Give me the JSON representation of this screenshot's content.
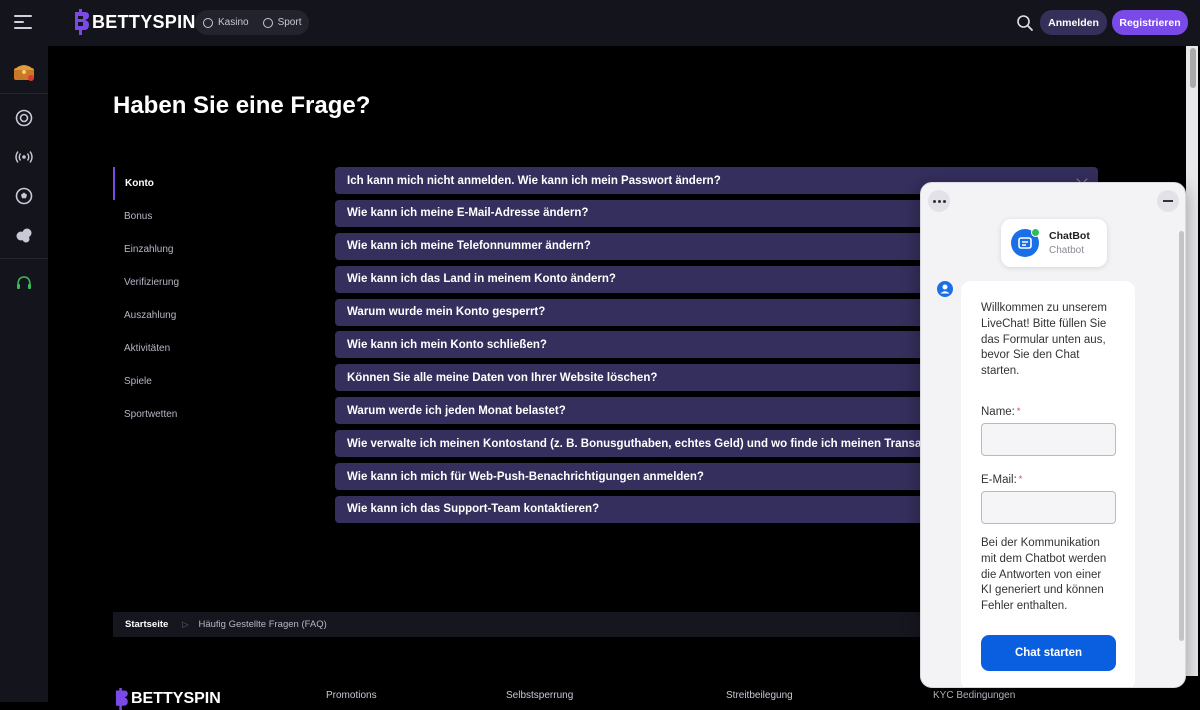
{
  "header": {
    "logo_text": "BETTYSPIN",
    "nav": [
      {
        "label": "Kasino",
        "icon": "casino-chip-icon"
      },
      {
        "label": "Sport",
        "icon": "soccer-ball-icon"
      }
    ],
    "login_label": "Anmelden",
    "register_label": "Registrieren"
  },
  "sidebar": {
    "icons": [
      "treasure-chest-icon",
      "roulette-icon",
      "live-broadcast-icon",
      "soccer-ball-icon",
      "poker-chips-icon",
      "support-headset-icon"
    ]
  },
  "page": {
    "title": "Haben Sie eine Frage?"
  },
  "categories": [
    {
      "label": "Konto",
      "active": true
    },
    {
      "label": "Bonus"
    },
    {
      "label": "Einzahlung"
    },
    {
      "label": "Verifizierung"
    },
    {
      "label": "Auszahlung"
    },
    {
      "label": "Aktivitäten"
    },
    {
      "label": "Spiele"
    },
    {
      "label": "Sportwetten"
    }
  ],
  "faq": [
    "Ich kann mich nicht anmelden. Wie kann ich mein Passwort ändern?",
    "Wie kann ich meine E-Mail-Adresse ändern?",
    "Wie kann ich meine Telefonnummer ändern?",
    "Wie kann ich das Land in meinem Konto ändern?",
    "Warum wurde mein Konto gesperrt?",
    "Wie kann ich mein Konto schließen?",
    "Können Sie alle meine Daten von Ihrer Website löschen?",
    "Warum werde ich jeden Monat belastet?",
    "Wie verwalte ich meinen Kontostand (z. B. Bonusguthaben, echtes Geld) und wo finde ich meinen Transak",
    "Wie kann ich mich für Web-Push-Benachrichtigungen anmelden?",
    "Wie kann ich das Support-Team kontaktieren?"
  ],
  "breadcrumb": {
    "home": "Startseite",
    "current": "Häufig Gestellte Fragen (FAQ)"
  },
  "footer": {
    "links": [
      "Promotions",
      "Selbstsperrung",
      "Streitbeilegung",
      "KYC Bedingungen"
    ]
  },
  "chat": {
    "bot_name": "ChatBot",
    "bot_role": "Chatbot",
    "welcome": "Willkommen zu unserem LiveChat! Bitte füllen Sie das Formular unten aus, bevor Sie den Chat starten.",
    "name_label": "Name:",
    "email_label": "E-Mail:",
    "required_mark": "*",
    "note": "Bei der Kommunikation mit dem Chatbot werden die Antworten von einer KI generiert und können Fehler enthalten.",
    "start_label": "Chat starten"
  },
  "colors": {
    "accent": "#7a4ae8",
    "faq_bg": "#342f5c",
    "chat_button": "#0a5fe0"
  }
}
